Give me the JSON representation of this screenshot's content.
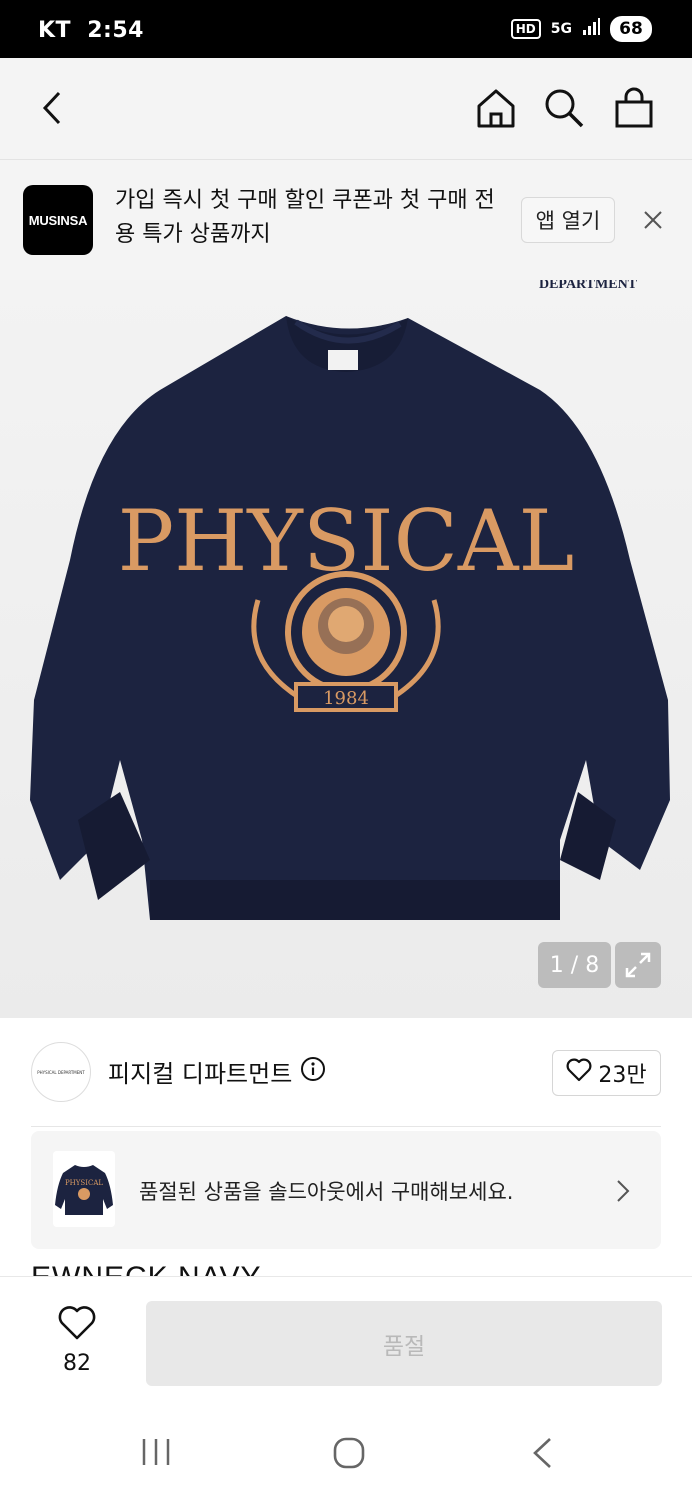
{
  "status_bar": {
    "carrier": "KT",
    "time": "2:54",
    "hd": "HD",
    "network": "5G",
    "battery": "68"
  },
  "nav": {
    "back_icon": "back-arrow-icon",
    "home_icon": "home-icon",
    "search_icon": "search-icon",
    "bag_icon": "shopping-bag-icon"
  },
  "banner": {
    "logo_text": "MUSINSA",
    "message": "가입 즉시 첫 구매 할인 쿠폰과 첫 구매 전용 특가 상품까지",
    "open_label": "앱 열기",
    "close_icon": "close-icon"
  },
  "product_image": {
    "print_text": "PHYSICAL",
    "badge_year": "1984",
    "top_fragment": "DEPARTMENT",
    "counter": "1 / 8",
    "expand_icon": "expand-icon",
    "colors": {
      "sweater": "#1c2340",
      "print": "#d99a63"
    }
  },
  "brand": {
    "avatar_text": "PHYSICAL DEPARTMENT",
    "name": "피지컬 디파트먼트",
    "info_icon": "info-icon",
    "likes": "23만"
  },
  "soldout": {
    "message": "품절된 상품을 솔드아웃에서 구매해보세요.",
    "arrow_icon": "chevron-right-icon"
  },
  "product_title_partial": "EWNECK NAVY",
  "bottom": {
    "wish_count": "82",
    "buy_label": "품절"
  },
  "system_nav": {
    "recent_icon": "recent-apps-icon",
    "home_icon": "home-circle-icon",
    "back_icon": "back-icon"
  }
}
